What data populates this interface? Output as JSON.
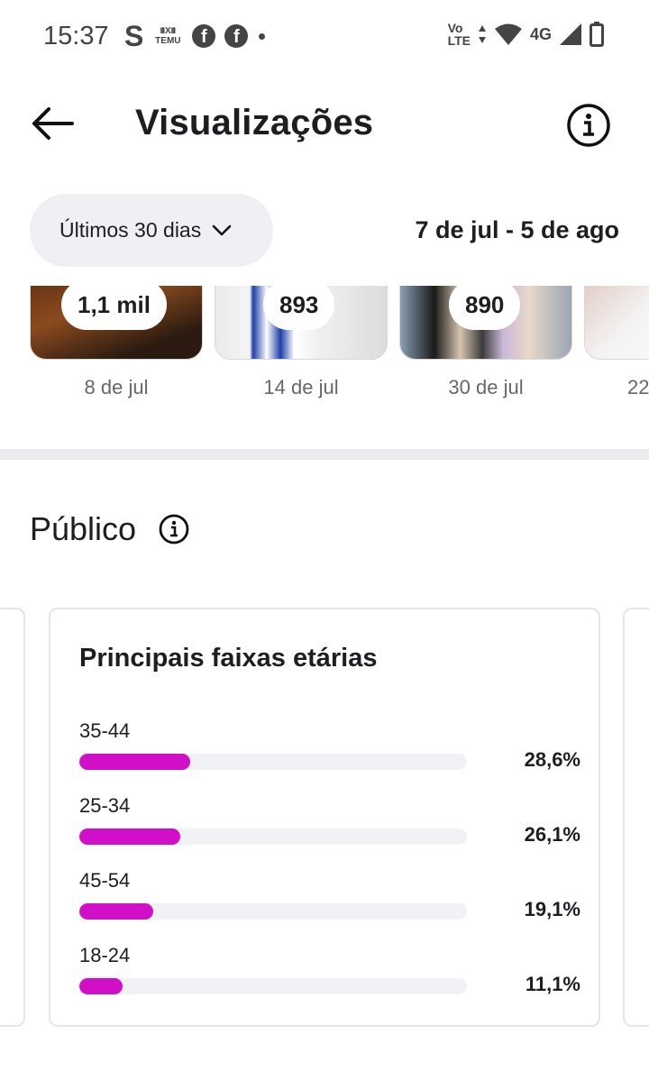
{
  "status_bar": {
    "time": "15:37",
    "s_app": "S",
    "temu_top": "⩩X⩩",
    "temu_bottom": "TEMU",
    "facebook_glyph": "f",
    "network": "4G",
    "volte_top": "Vo",
    "volte_bottom": "LTE",
    "icons": [
      "s-app-icon",
      "temu-icon",
      "facebook-icon",
      "facebook-icon",
      "notification-dot-icon",
      "volte-icon",
      "data-arrows-icon",
      "wifi-icon",
      "network-4g-icon",
      "signal-icon",
      "battery-icon"
    ]
  },
  "header": {
    "title": "Visualizações",
    "back_icon": "back-arrow-icon",
    "info_icon": "info-icon"
  },
  "filters": {
    "range_label": "Últimos 30 dias",
    "date_range": "7 de jul - 5 de ago"
  },
  "posts": [
    {
      "count": "1,1 mil",
      "date": "8 de jul"
    },
    {
      "count": "893",
      "date": "14 de jul"
    },
    {
      "count": "890",
      "date": "30 de jul"
    },
    {
      "count": "",
      "date": "22"
    }
  ],
  "audience": {
    "title": "Público",
    "card_title": "Principais faixas etárias",
    "bar_color": "#d10fc9",
    "age_groups": [
      {
        "label": "35-44",
        "pct_text": "28,6%",
        "value": 28.6
      },
      {
        "label": "25-34",
        "pct_text": "26,1%",
        "value": 26.1
      },
      {
        "label": "45-54",
        "pct_text": "19,1%",
        "value": 19.1
      },
      {
        "label": "18-24",
        "pct_text": "11,1%",
        "value": 11.1
      }
    ]
  }
}
